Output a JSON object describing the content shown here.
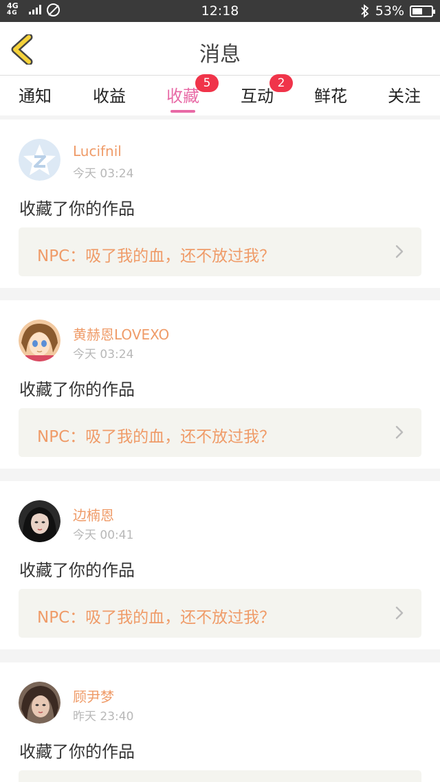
{
  "status_bar": {
    "network_top": "4G",
    "network_bottom": "4G",
    "time": "12:18",
    "battery_percent": "53%",
    "battery_level": 0.53
  },
  "header": {
    "title": "消息",
    "back_icon": "chevron-left-icon"
  },
  "tabs": [
    {
      "label": "通知"
    },
    {
      "label": "收益"
    },
    {
      "label": "收藏",
      "badge": "5",
      "active": true
    },
    {
      "label": "互动",
      "badge": "2"
    },
    {
      "label": "鲜花"
    },
    {
      "label": "关注"
    }
  ],
  "colors": {
    "accent_pink": "#e86aa6",
    "username_orange": "#ef9b68",
    "badge_red": "#f0344a",
    "back_arrow_yellow": "#f5d23a"
  },
  "items": [
    {
      "username": "Lucifnil",
      "time": "今天 03:24",
      "message": "收藏了你的作品",
      "work_title": "NPC：吸了我的血，还不放过我？",
      "avatar": "default-avatar"
    },
    {
      "username": "黄赫恩LOVEXO",
      "time": "今天 03:24",
      "message": "收藏了你的作品",
      "work_title": "NPC：吸了我的血，还不放过我？",
      "avatar": "anime-girl-avatar"
    },
    {
      "username": "边楠恩",
      "time": "今天 00:41",
      "message": "收藏了你的作品",
      "work_title": "NPC：吸了我的血，还不放过我？",
      "avatar": "woman-photo-avatar"
    },
    {
      "username": "顾尹梦",
      "time": "昨天 23:40",
      "message": "收藏了你的作品",
      "work_title": "",
      "avatar": "woman-photo-avatar"
    }
  ]
}
